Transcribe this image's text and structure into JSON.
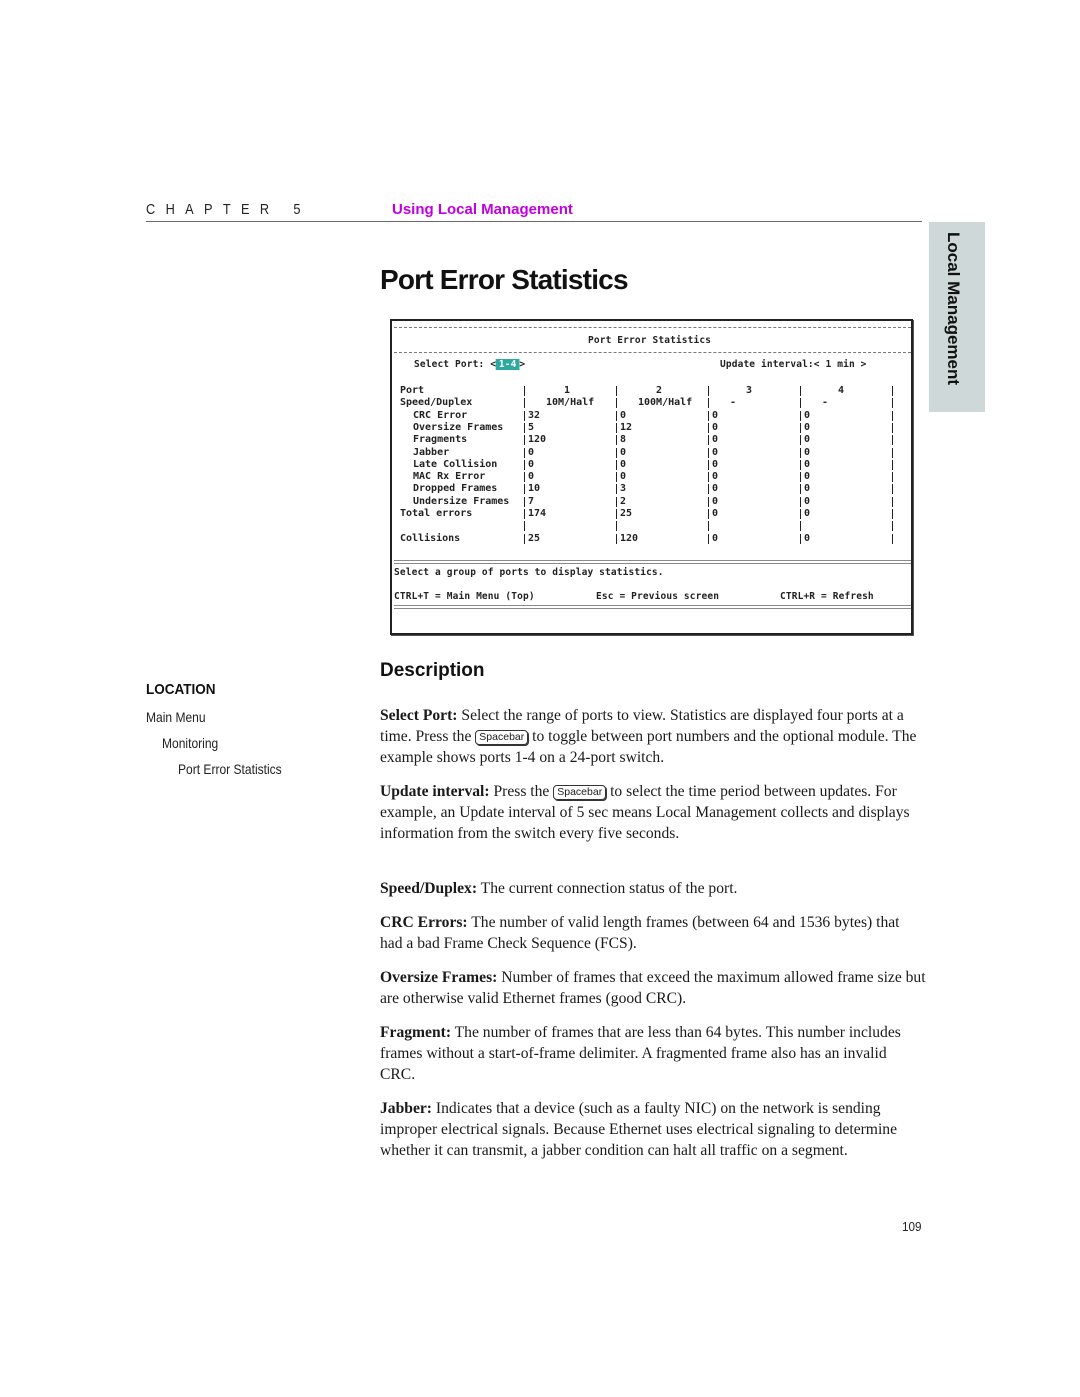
{
  "header": {
    "chapter_label": "CHAPTER 5",
    "chapter_title": "Using Local Management",
    "accent_color": "#c000e0"
  },
  "side_tab": {
    "label": "Local Management",
    "color": "#cfd8d8"
  },
  "page_title": "Port Error Statistics",
  "terminal": {
    "title": "Port Error Statistics",
    "select_port_label": "Select Port: <",
    "select_port_value": "1-4",
    "select_port_close": ">",
    "update_interval": "Update interval:< 1 min >",
    "highlight_color": "#2fa8a0",
    "columns": [
      "Port",
      "1",
      "2",
      "3",
      "4"
    ],
    "rows": [
      {
        "label": "Speed/Duplex",
        "indent": false,
        "values": [
          "10M/Half",
          "100M/Half",
          "-",
          "-"
        ]
      },
      {
        "label": "CRC Error",
        "indent": true,
        "values": [
          "32",
          "0",
          "0",
          "0"
        ]
      },
      {
        "label": "Oversize Frames",
        "indent": true,
        "values": [
          "5",
          "12",
          "0",
          "0"
        ]
      },
      {
        "label": "Fragments",
        "indent": true,
        "values": [
          "120",
          "8",
          "0",
          "0"
        ]
      },
      {
        "label": "Jabber",
        "indent": true,
        "values": [
          "0",
          "0",
          "0",
          "0"
        ]
      },
      {
        "label": "Late Collision",
        "indent": true,
        "values": [
          "0",
          "0",
          "0",
          "0"
        ]
      },
      {
        "label": "MAC Rx Error",
        "indent": true,
        "values": [
          "0",
          "0",
          "0",
          "0"
        ]
      },
      {
        "label": "Dropped Frames",
        "indent": true,
        "values": [
          "10",
          "3",
          "0",
          "0"
        ]
      },
      {
        "label": "Undersize Frames",
        "indent": true,
        "values": [
          "7",
          "2",
          "0",
          "0"
        ]
      },
      {
        "label": "Total errors",
        "indent": false,
        "values": [
          "174",
          "25",
          "0",
          "0"
        ]
      },
      {
        "label": "",
        "indent": false,
        "values": [
          "",
          "",
          "",
          ""
        ]
      },
      {
        "label": "Collisions",
        "indent": false,
        "values": [
          "25",
          "120",
          "0",
          "0"
        ]
      }
    ],
    "status_message": "Select a group of ports to display statistics.",
    "shortcuts": [
      "CTRL+T = Main Menu (Top)",
      "Esc = Previous screen",
      "CTRL+R = Refresh"
    ]
  },
  "location": {
    "heading": "LOCATION",
    "path": [
      "Main Menu",
      "Monitoring",
      "Port Error Statistics"
    ]
  },
  "description": {
    "heading": "Description",
    "key_label": "Spacebar",
    "paragraphs": [
      {
        "term": "Select Port:",
        "text_before_key": " Select the range of ports to view. Statistics are displayed four ports at a time. Press the ",
        "text_after_key": " to toggle between port numbers and the optional module. The example shows ports 1-4 on a 24-port switch."
      },
      {
        "term": "Update interval:",
        "text_before_key": " Press the ",
        "text_after_key": " to select the time period between updates. For example, an Update interval of 5 sec means Local Management collects and displays information from the switch every five seconds."
      },
      {
        "term": "Speed/Duplex:",
        "text": " The current connection status of the port."
      },
      {
        "term": "CRC Errors:",
        "text": " The number of valid length frames (between 64 and 1536 bytes) that had a bad Frame Check Sequence (FCS)."
      },
      {
        "term": "Oversize Frames:",
        "text": " Number of frames that exceed the maximum allowed frame size but are otherwise valid Ethernet frames (good CRC)."
      },
      {
        "term": "Fragment:",
        "text": " The number of frames that are less than 64 bytes. This number includes frames without a start-of-frame delimiter. A fragmented frame also has an invalid CRC."
      },
      {
        "term": "Jabber:",
        "text": " Indicates that a device (such as a faulty NIC) on the network is sending improper electrical signals. Because Ethernet uses electrical signaling to determine whether it can transmit, a jabber condition can halt all traffic on a segment."
      }
    ]
  },
  "page_number": "109"
}
